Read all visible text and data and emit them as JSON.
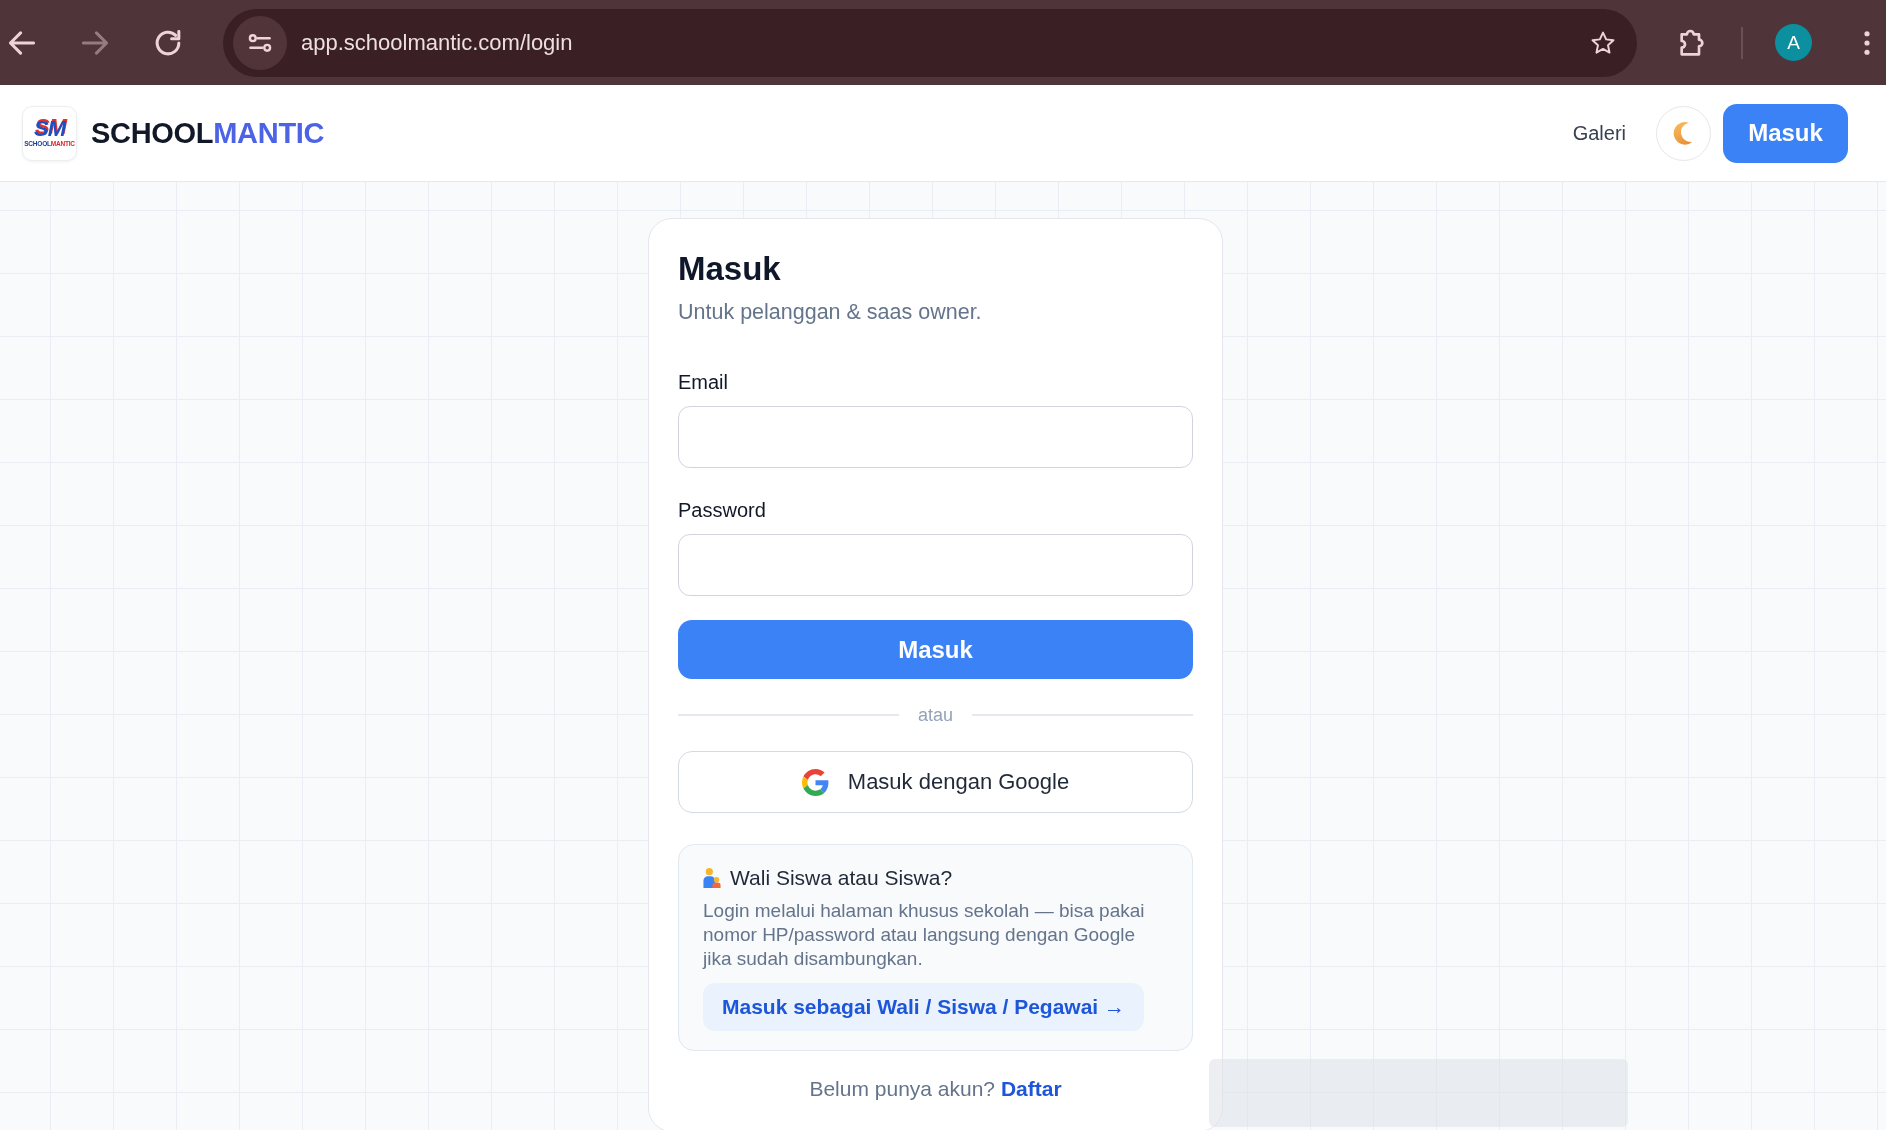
{
  "browser": {
    "nav_buttons": [
      {
        "kind": "back",
        "disabled": false
      },
      {
        "kind": "forward",
        "disabled": true
      },
      {
        "kind": "reload",
        "disabled": false
      }
    ],
    "url": "app.schoolmantic.com/login",
    "profile_initial": "A"
  },
  "header": {
    "logo": {
      "monogram": "SM",
      "caption": [
        {
          "text": "SCHOOL",
          "kind": "plain"
        },
        {
          "text": "MANTIC",
          "kind": "accent"
        }
      ]
    },
    "brand": [
      {
        "text": "SCHOOL",
        "kind": "plain"
      },
      {
        "text": "MANTIC",
        "kind": "accent"
      }
    ],
    "nav_links": [
      "Galeri"
    ],
    "login_button": "Masuk"
  },
  "card": {
    "title": "Masuk",
    "subtitle": "Untuk pelanggan & saas owner.",
    "fields": [
      {
        "label": "Email"
      },
      {
        "label": "Password"
      }
    ],
    "submit": "Masuk",
    "divider": "atau",
    "google_button": "Masuk dengan Google",
    "info": {
      "title": "Wali Siswa atau Siswa?",
      "text": "Login melalui halaman khusus sekolah — bisa pakai nomor HP/password atau langsung dengan Google jika sudah disambungkan.",
      "link": "Masuk sebagai Wali / Siswa / Pegawai →"
    },
    "footer": {
      "prompt": "Belum punya akun?",
      "link": "Daftar"
    }
  }
}
